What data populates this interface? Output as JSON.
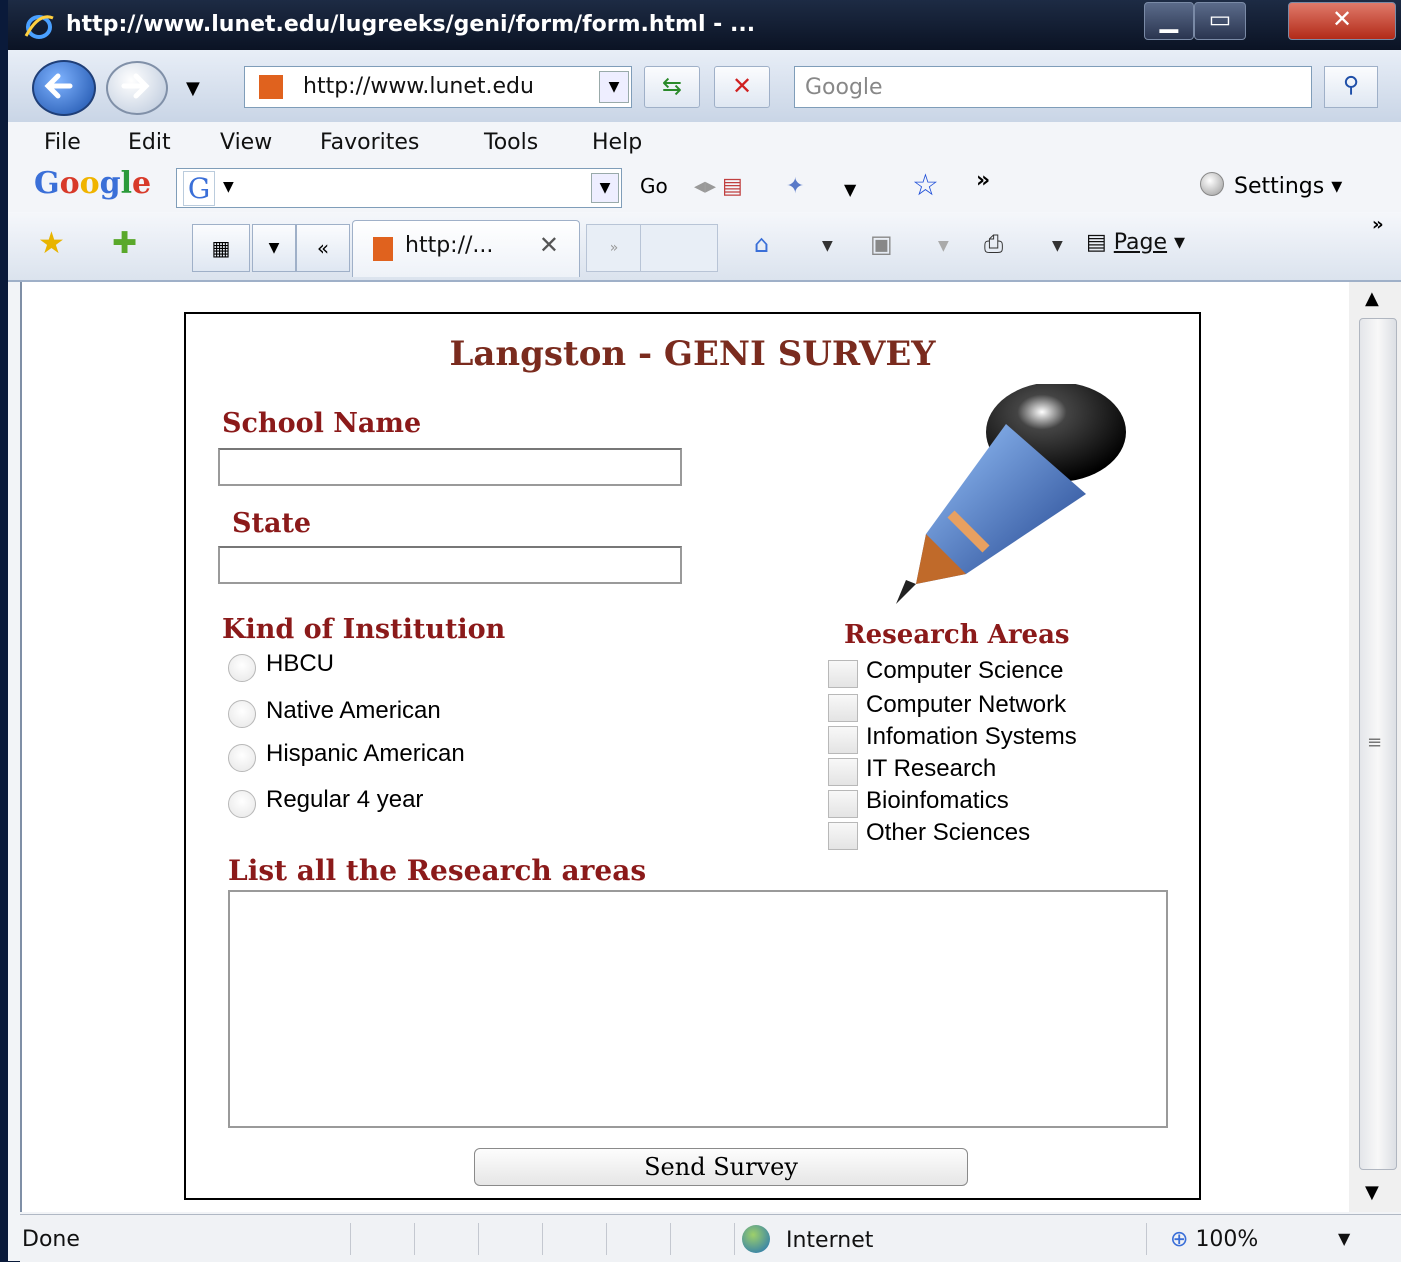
{
  "window": {
    "title": "http://www.lunet.edu/lugreeks/geni/form/form.html - ...",
    "minimize": "▁",
    "maximize": "▭",
    "close": "✕"
  },
  "address": {
    "url": "http://www.lunet.edu",
    "search_placeholder": "Google"
  },
  "menu": [
    "File",
    "Edit",
    "View",
    "Favorites",
    "Tools",
    "Help"
  ],
  "googlebar": {
    "logo": "Google",
    "g": "G",
    "go": "Go",
    "settings": "Settings"
  },
  "tabs": {
    "back_all": "«",
    "active_tab_label": "http://...",
    "active_tab_close": "✕",
    "more": "»",
    "page_menu": "Page"
  },
  "form": {
    "title": "Langston - GENI SURVEY",
    "school_label": "School Name",
    "state_label": "State",
    "institution_label": "Kind of Institution",
    "institution_options": [
      "HBCU",
      "Native American",
      "Hispanic American",
      "Regular 4 year"
    ],
    "research_label": "Research Areas",
    "research_options": [
      "Computer Science",
      "Computer Network",
      "Infomation Systems",
      "IT Research",
      "Bioinfomatics",
      "Other Sciences"
    ],
    "list_label": "List all the Research areas",
    "submit": "Send Survey"
  },
  "status": {
    "text": "Done",
    "zone": "Internet",
    "zoom": "100%"
  },
  "colors": {
    "label": "#8b1a1a",
    "title": "#7a2b1e"
  }
}
